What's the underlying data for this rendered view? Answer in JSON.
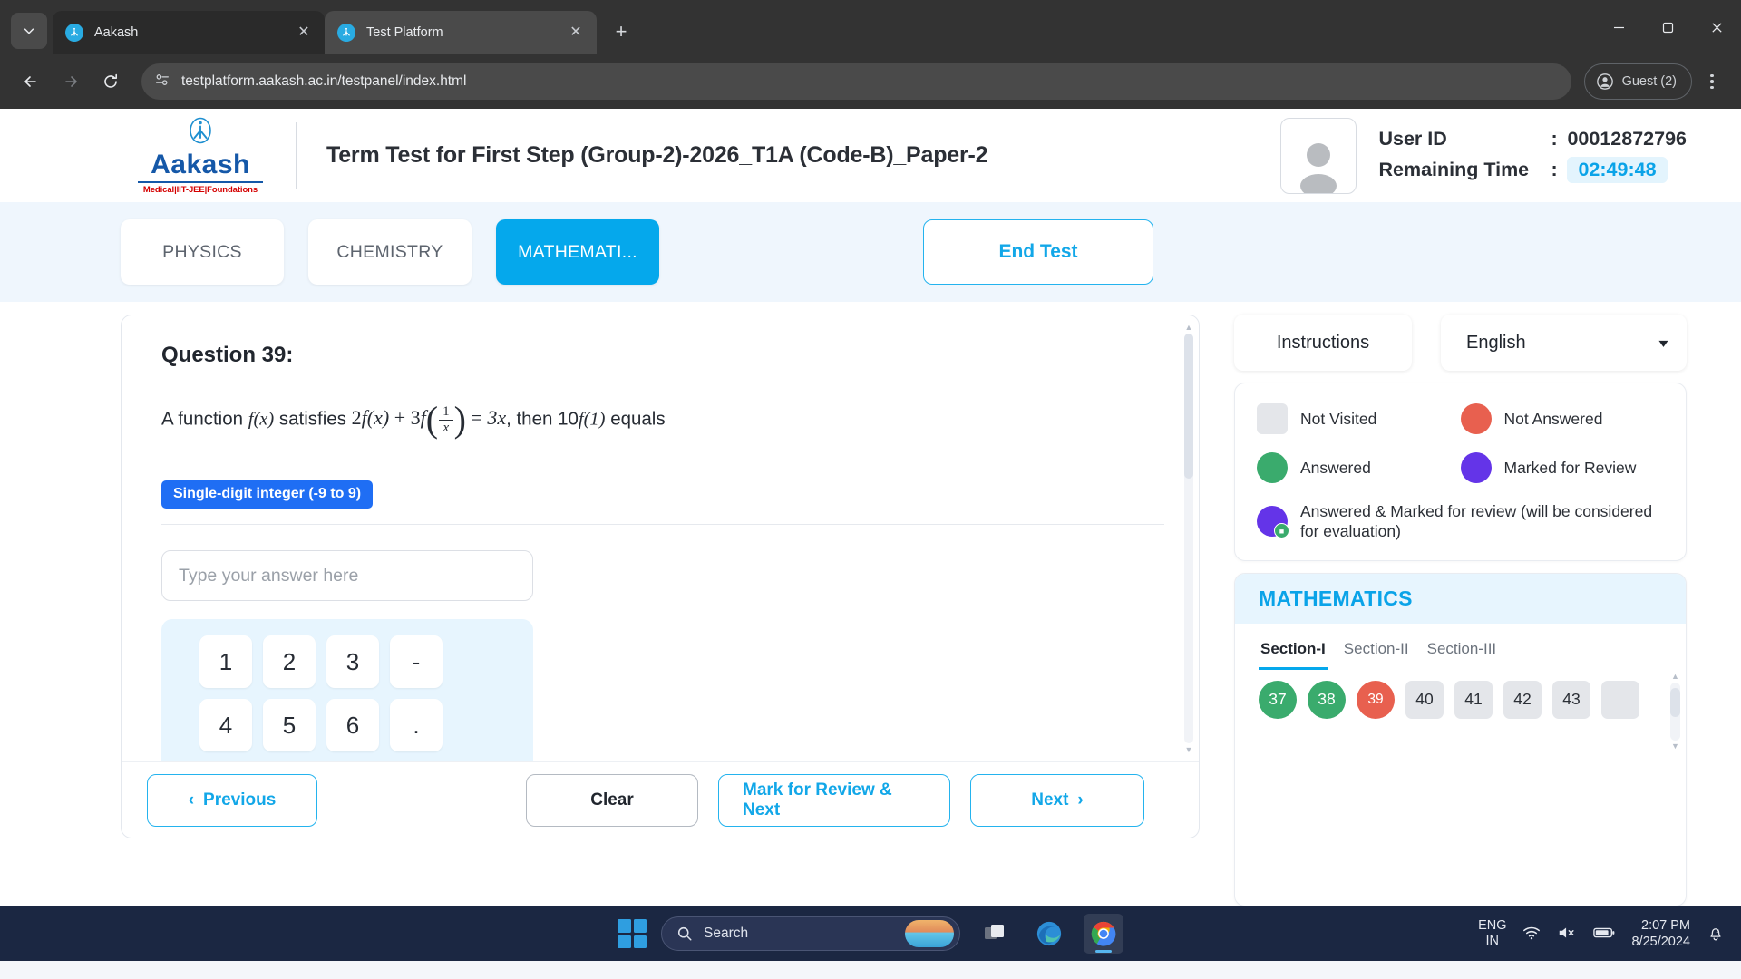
{
  "browser": {
    "tabs": [
      {
        "title": "Aakash",
        "active": false,
        "icon": "aakash-favicon"
      },
      {
        "title": "Test Platform",
        "active": true,
        "icon": "aakash-favicon"
      }
    ],
    "new_tab_label": "+",
    "window_controls": {
      "minimize": "—",
      "maximize": "❐",
      "close": "✕"
    },
    "url": "testplatform.aakash.ac.in/testpanel/index.html",
    "profile_label": "Guest (2)"
  },
  "header": {
    "logo_name": "Aakash",
    "logo_sub": "Medical|IIT-JEE|Foundations",
    "test_title": "Term Test for First Step (Group-2)-2026_T1A (Code-B)_Paper-2",
    "user_id_label": "User ID",
    "user_id_value": "00012872796",
    "remaining_time_label": "Remaining Time",
    "remaining_time_value": "02:49:48",
    "colon": ":"
  },
  "subject_bar": {
    "tabs": [
      {
        "label": "PHYSICS",
        "active": false
      },
      {
        "label": "CHEMISTRY",
        "active": false
      },
      {
        "label": "MATHEMATI...",
        "active": true
      }
    ],
    "end_test_label": "End Test"
  },
  "question": {
    "heading": "Question 39:",
    "text_before": "A function",
    "fx": "f(x)",
    "text_mid": "satisfies",
    "formula": {
      "lhs_a": "2",
      "fn_a": "f(x)",
      "plus": "+",
      "lhs_b": "3",
      "fn_b": "f",
      "frac_num": "1",
      "frac_den": "x",
      "equals": "=",
      "rhs": "3x"
    },
    "text_after": ", then 10",
    "f1": "f(1)",
    "text_end": "equals",
    "type_badge": "Single-digit integer (-9 to 9)",
    "input_placeholder": "Type your answer here",
    "input_value": "",
    "keypad": [
      [
        "1",
        "2",
        "3",
        "-"
      ],
      [
        "4",
        "5",
        "6",
        "."
      ]
    ]
  },
  "actions": {
    "previous": "Previous",
    "clear": "Clear",
    "mark_review_next": "Mark for Review & Next",
    "next": "Next",
    "prev_chevron": "‹",
    "next_chevron": "›"
  },
  "side": {
    "instructions_label": "Instructions",
    "language_value": "English",
    "legend": [
      {
        "label": "Not Visited",
        "color": "#e4e6ea",
        "shape": "square"
      },
      {
        "label": "Not Answered",
        "color": "#e8604f",
        "shape": "circle"
      },
      {
        "label": "Answered",
        "color": "#3aab6d",
        "shape": "circle"
      },
      {
        "label": "Marked for Review",
        "color": "#6434e8",
        "shape": "circle"
      },
      {
        "label": "Answered & Marked for review (will be considered for evaluation)",
        "color": "#6434e8",
        "shape": "circle-tick"
      }
    ],
    "palette_title": "MATHEMATICS",
    "sections": [
      {
        "label": "Section-I",
        "active": true
      },
      {
        "label": "Section-II",
        "active": false
      },
      {
        "label": "Section-III",
        "active": false
      }
    ],
    "questions": [
      {
        "num": "37",
        "state": "answered"
      },
      {
        "num": "38",
        "state": "answered"
      },
      {
        "num": "39",
        "state": "not-answered"
      },
      {
        "num": "40",
        "state": "not-visited"
      },
      {
        "num": "41",
        "state": "not-visited"
      },
      {
        "num": "42",
        "state": "not-visited"
      },
      {
        "num": "43",
        "state": "not-visited"
      }
    ]
  },
  "taskbar": {
    "search_placeholder": "Search",
    "language": "ENG",
    "region": "IN",
    "time": "2:07 PM",
    "date": "8/25/2024",
    "apps": [
      "start-icon",
      "search-box",
      "task-view-icon",
      "edge-icon",
      "chrome-icon"
    ],
    "tray_icons": [
      "wifi-icon",
      "volume-muted-icon",
      "battery-icon",
      "notifications-icon"
    ]
  },
  "colors": {
    "accent": "#05a8ec",
    "answered": "#3aab6d",
    "not_answered": "#e8604f",
    "marked": "#6434e8",
    "not_visited": "#e4e6ea",
    "badge_blue": "#1f6ef4"
  }
}
